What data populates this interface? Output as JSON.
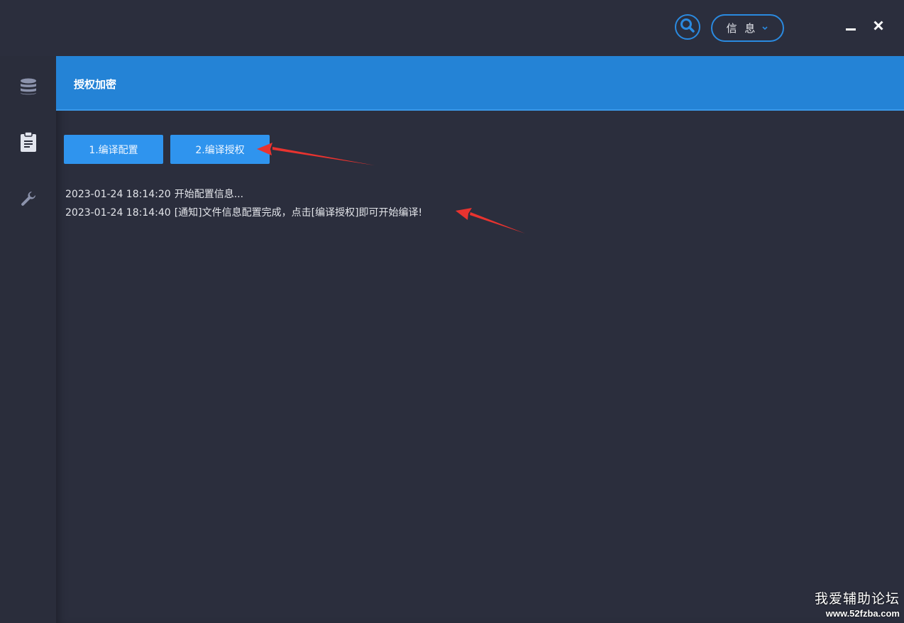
{
  "titlebar": {
    "search_icon": "search-icon",
    "info_dropdown_label": "信 息",
    "minimize_icon": "minimize-icon",
    "close_icon": "close-icon"
  },
  "sidebar": {
    "items": [
      {
        "icon": "database-icon"
      },
      {
        "icon": "clipboard-icon"
      },
      {
        "icon": "wrench-icon"
      }
    ]
  },
  "header": {
    "title": "授权加密"
  },
  "actions": {
    "compile_config_label": "1.编译配置",
    "compile_auth_label": "2.编译授权"
  },
  "log": {
    "entries": [
      {
        "time": "2023-01-24 18:14:20",
        "message": "开始配置信息..."
      },
      {
        "time": "2023-01-24 18:14:40",
        "message": "[通知]文件信息配置完成，点击[编译授权]即可开始编译!"
      }
    ]
  },
  "watermark": {
    "name": "我爱辅助论坛",
    "url": "www.52fzba.com"
  },
  "colors": {
    "background": "#2b2e3d",
    "accent": "#2483d6",
    "button": "#2f94ee",
    "annotation_arrow": "#e8332f"
  }
}
